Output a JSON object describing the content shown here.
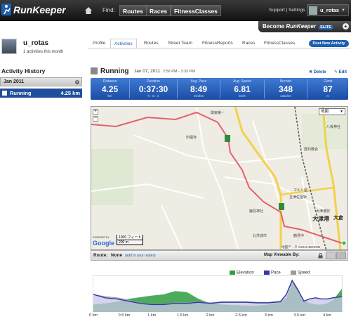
{
  "topbar": {
    "brand": "RunKeeper",
    "find_label": "Find:",
    "nav": [
      "Routes",
      "Races",
      "FitnessClasses"
    ],
    "support": "Support | Settings",
    "username": "u_rotas"
  },
  "become": {
    "prefix": "Become",
    "brand": "RunKeeper",
    "tier": "ELITE"
  },
  "profile": {
    "name": "u_rotas",
    "activities_count": "1 activities this month",
    "tabs": [
      "Profile",
      "Activities",
      "Routes",
      "Street Team",
      "FitnessReports",
      "Races",
      "FitnessClasses"
    ],
    "active_tab": "Activities",
    "post_button": "Post New Activity"
  },
  "history": {
    "title": "Activity History",
    "month": "Jan 2011",
    "items": [
      {
        "label": "Running",
        "distance": "4.25 km"
      }
    ]
  },
  "activity": {
    "title": "Running",
    "date": "Jan 07, 2011",
    "time": "2:56 PM - 3:33 PM",
    "delete_label": "Delete",
    "edit_label": "Edit",
    "stats": [
      {
        "label": "Distance",
        "value": "4.25",
        "unit": "km"
      },
      {
        "label": "Duration",
        "value": "0:37:30",
        "unit": "h : m : s"
      },
      {
        "label": "Avg. Pace",
        "value": "8:49",
        "unit": "min/km"
      },
      {
        "label": "Avg. Speed",
        "value": "6.81",
        "unit": "km/h"
      },
      {
        "label": "Burned",
        "value": "348",
        "unit": "calories"
      },
      {
        "label": "Climb",
        "value": "87",
        "unit": "m"
      }
    ]
  },
  "map": {
    "type_label": "地図",
    "scale_ft": "1000 フィート",
    "scale_m": "200 m",
    "google": "Google",
    "powered_by": "POWERED BY",
    "copyright": "地図データ ©2010 ZENRIN",
    "labels": [
      "関東第一",
      "八坂神社",
      "五津佐屋坂",
      "農村教会",
      "鶴見中",
      "大津港",
      "旧福寺",
      "北茨城市",
      "鹿島神社",
      "大倉",
      "大津港駅",
      "マルト屋"
    ]
  },
  "route_bar": {
    "route_label": "Route:",
    "route_value": "None",
    "add_link": "(add to your routes)",
    "viewable_label": "Map Viewable By:"
  },
  "chart_data": {
    "type": "area",
    "series": [
      {
        "name": "Elevation",
        "color": "#2e9e3e"
      },
      {
        "name": "Pace",
        "color": "#2f3aa8"
      },
      {
        "name": "Speed",
        "color": "#9b9b9b"
      }
    ],
    "x_ticks": [
      "0 km",
      "0.5 km",
      "1 km",
      "1.5 km",
      "2 km",
      "2.5 km",
      "3 km",
      "3.5 km",
      "4 km"
    ],
    "x": [
      0,
      0.2,
      0.4,
      0.6,
      0.8,
      1.0,
      1.2,
      1.4,
      1.6,
      1.8,
      2.0,
      2.2,
      2.4,
      2.6,
      2.8,
      3.0,
      3.2,
      3.3,
      3.4,
      3.5,
      3.6,
      3.7,
      3.8,
      3.9,
      4.0,
      4.1,
      4.25
    ],
    "elevation": [
      12,
      14,
      17,
      22,
      25,
      28,
      30,
      36,
      34,
      22,
      14,
      12,
      11,
      10,
      10,
      12,
      16,
      24,
      50,
      38,
      20,
      14,
      12,
      12,
      14,
      20,
      40
    ],
    "pace": [
      30,
      24,
      22,
      18,
      14,
      12,
      12,
      14,
      14,
      16,
      14,
      16,
      16,
      16,
      15,
      15,
      17,
      30,
      55,
      38,
      18,
      22,
      24,
      22,
      22,
      24,
      26
    ],
    "speed": [
      30,
      26,
      24,
      20,
      15,
      13,
      13,
      15,
      15,
      17,
      15,
      17,
      17,
      17,
      16,
      16,
      18,
      30,
      52,
      36,
      19,
      22,
      24,
      22,
      22,
      24,
      26
    ],
    "ylim": [
      0,
      60
    ]
  }
}
